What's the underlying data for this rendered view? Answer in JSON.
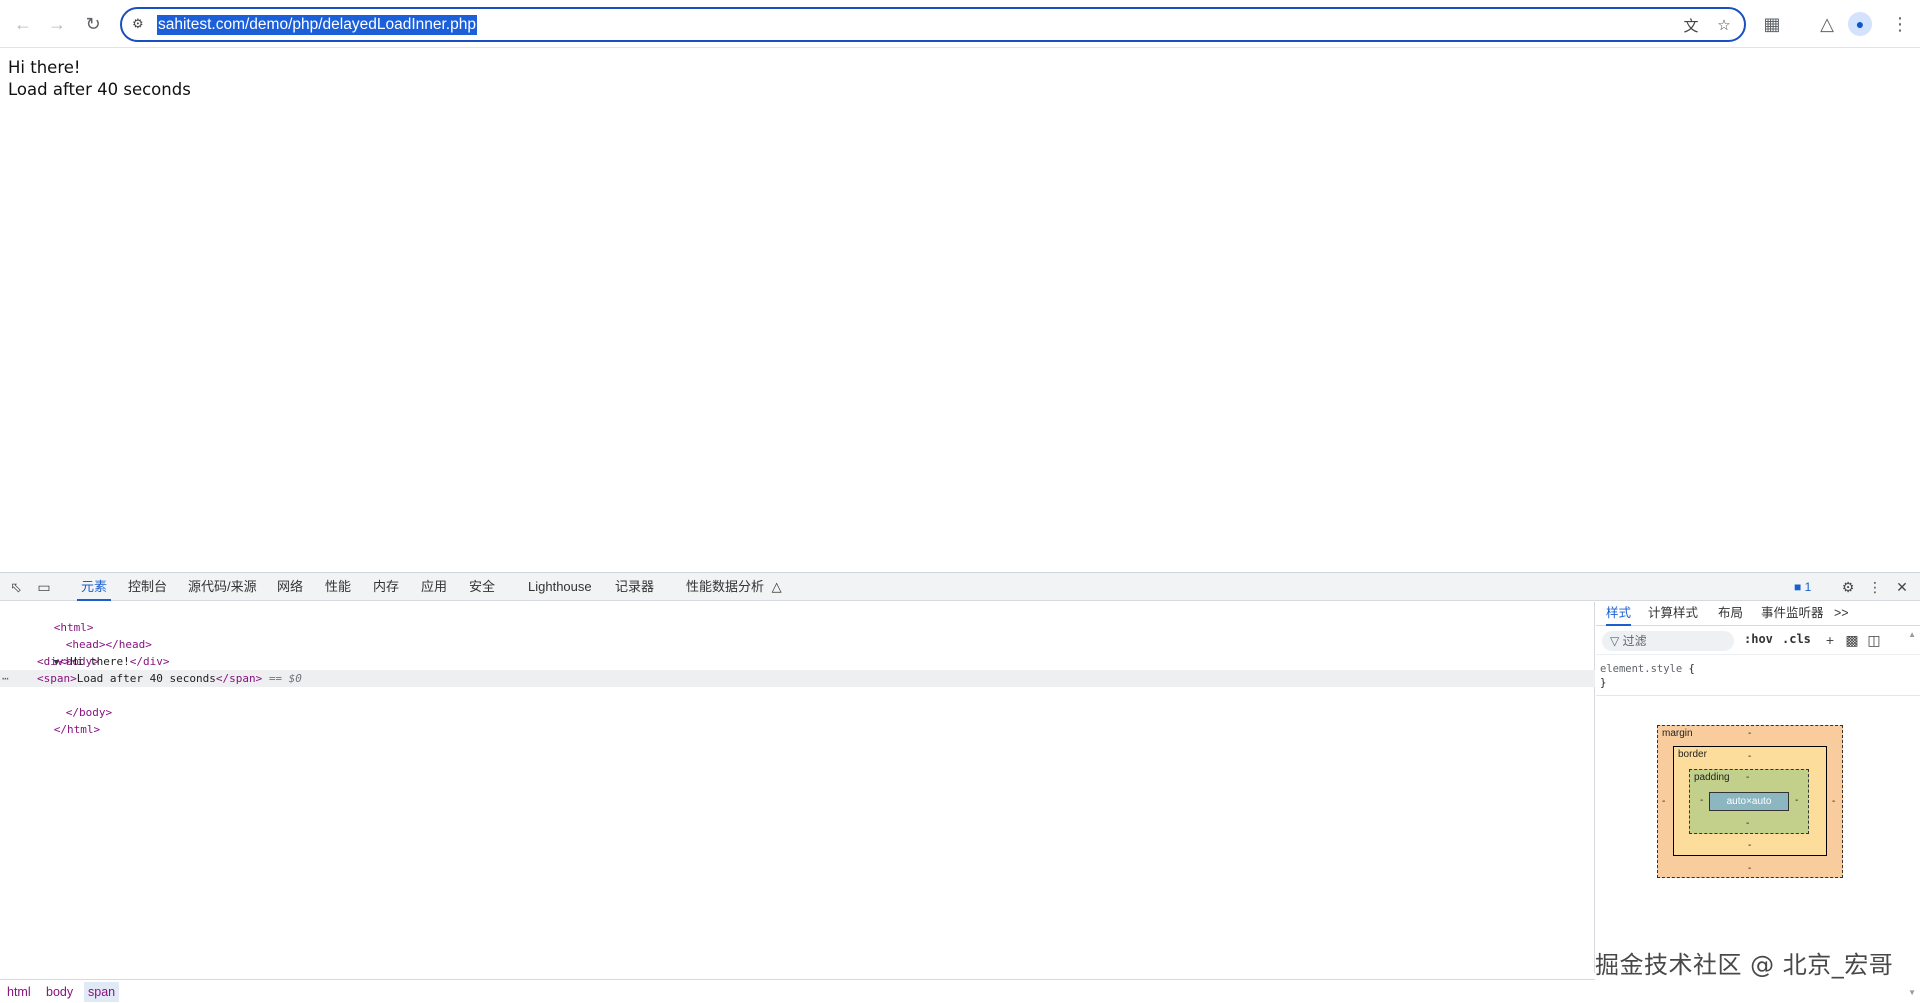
{
  "browser": {
    "url": "sahitest.com/demo/php/delayedLoadInner.php",
    "icons": {
      "back": "arrow-left-icon",
      "forward": "arrow-right-icon",
      "reload": "reload-icon",
      "site_info": "tune-icon",
      "translate": "translate-icon",
      "bookmark": "star-icon",
      "extensions": "puzzle-icon",
      "labs": "flask-icon",
      "profile": "person-icon",
      "menu": "kebab-icon"
    }
  },
  "page": {
    "line1": "Hi there!",
    "line2": "Load after 40 seconds"
  },
  "devtools": {
    "tabs": [
      "元素",
      "控制台",
      "源代码/来源",
      "网络",
      "性能",
      "内存",
      "应用",
      "安全",
      "Lighthouse",
      "记录器",
      "性能数据分析"
    ],
    "active_tab": "元素",
    "issues_count": "1",
    "dom": {
      "html_open": "<html>",
      "head": "<head></head>",
      "body_open": "<body>",
      "div_open": "<div>",
      "div_text": "Hi there!",
      "div_close": "</div>",
      "span_open": "<span>",
      "span_text": "Load after 40 seconds",
      "span_close": "</span>",
      "selected_marker": "== $0",
      "body_close": "</body>",
      "html_close": "</html>"
    },
    "breadcrumbs": [
      "html",
      "body",
      "span"
    ],
    "styles_panel": {
      "tabs": [
        "样式",
        "计算样式",
        "布局",
        "事件监听器"
      ],
      "more": ">>",
      "filter_placeholder": "过滤",
      "hov": ":hov",
      "cls": ".cls",
      "rule_selector": "element.style",
      "rule_open": "{",
      "rule_close": "}",
      "box_model": {
        "margin_label": "margin",
        "border_label": "border",
        "padding_label": "padding",
        "content": "auto×auto",
        "dash": "-"
      }
    }
  },
  "watermark": "掘金技术社区 @ 北京_宏哥"
}
